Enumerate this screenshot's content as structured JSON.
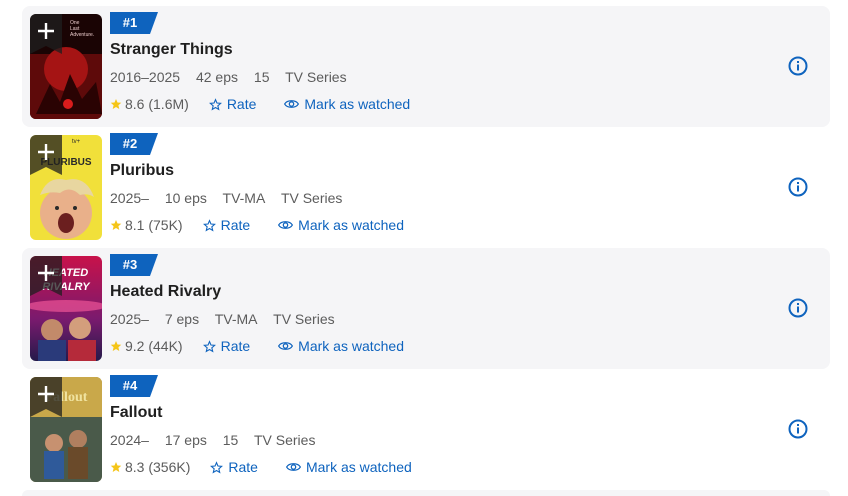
{
  "items": [
    {
      "rank": "#1",
      "title": "Stranger Things",
      "years": "2016–2025",
      "episodes": "42 eps",
      "certificate": "15",
      "type": "TV Series",
      "rating": "8.6",
      "votes": "(1.6M)",
      "rate_label": "Rate",
      "watch_label": "Mark as watched",
      "poster_icon": "stranger-things-poster"
    },
    {
      "rank": "#2",
      "title": "Pluribus",
      "years": "2025–",
      "episodes": "10 eps",
      "certificate": "TV-MA",
      "type": "TV Series",
      "rating": "8.1",
      "votes": "(75K)",
      "rate_label": "Rate",
      "watch_label": "Mark as watched",
      "poster_icon": "pluribus-poster",
      "poster_text": "PLURIBUS",
      "poster_brand": "tv+"
    },
    {
      "rank": "#3",
      "title": "Heated Rivalry",
      "years": "2025–",
      "episodes": "7 eps",
      "certificate": "TV-MA",
      "type": "TV Series",
      "rating": "9.2",
      "votes": "(44K)",
      "rate_label": "Rate",
      "watch_label": "Mark as watched",
      "poster_icon": "heated-rivalry-poster",
      "poster_text": "HEATED RIVALRY"
    },
    {
      "rank": "#4",
      "title": "Fallout",
      "years": "2024–",
      "episodes": "17 eps",
      "certificate": "15",
      "type": "TV Series",
      "rating": "8.3",
      "votes": "(356K)",
      "rate_label": "Rate",
      "watch_label": "Mark as watched",
      "poster_icon": "fallout-poster",
      "poster_text": "Fallout"
    }
  ],
  "colors": {
    "accent_blue": "#0e63be",
    "star_gold": "#f5c518",
    "row_shade": "#f5f5f7"
  },
  "icons": [
    "plus-icon",
    "star-icon",
    "star-outline-icon",
    "eye-icon",
    "info-icon"
  ]
}
